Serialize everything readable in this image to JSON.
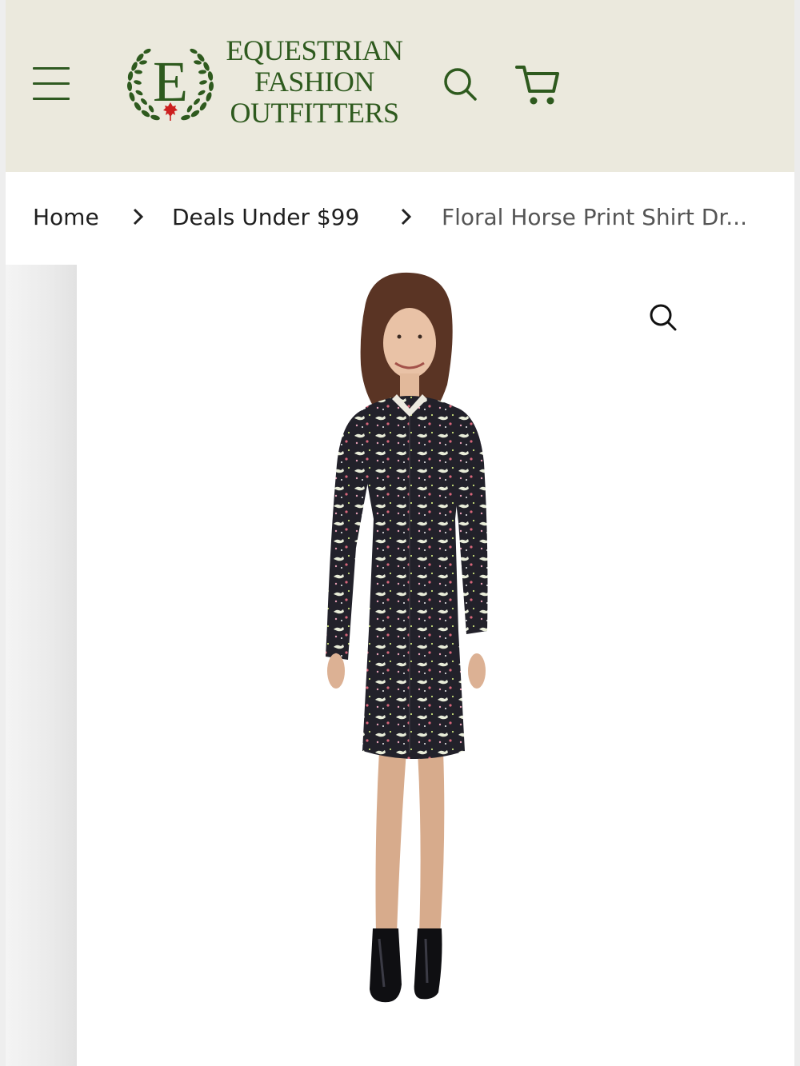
{
  "header": {
    "menu_icon": "hamburger-menu-icon",
    "logo": {
      "letter": "E",
      "line1": "EQUESTRIAN",
      "line2": "FASHION",
      "line3": "OUTFITTERS"
    },
    "search_icon": "search-icon",
    "cart_icon": "cart-icon",
    "brand_color": "#2e5a1e",
    "background_color": "#ebe9dd"
  },
  "breadcrumb": {
    "items": [
      {
        "label": "Home"
      },
      {
        "label": "Deals Under $99"
      },
      {
        "label": "Floral Horse Print Shirt Dr..."
      }
    ],
    "separator_icon": "chevron-right-icon"
  },
  "gallery": {
    "zoom_icon": "zoom-icon",
    "image_alt": "Woman wearing floral horse print shirt dress with black ankle boots"
  }
}
